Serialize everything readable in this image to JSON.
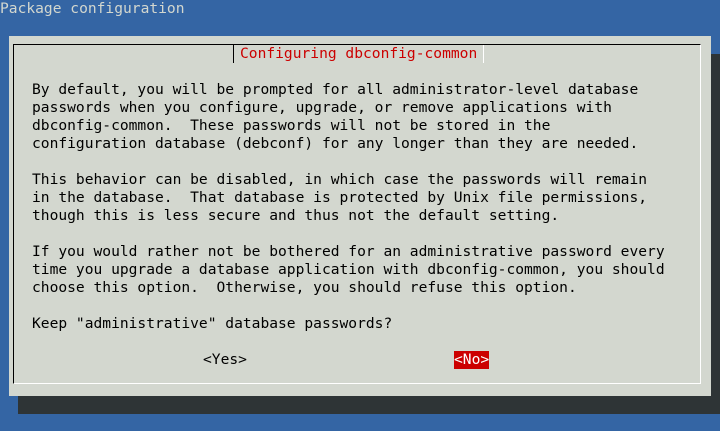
{
  "screen": {
    "title": "Package configuration"
  },
  "dialog": {
    "title": "Configuring dbconfig-common",
    "paragraphs": [
      "By default, you will be prompted for all administrator-level database\npasswords when you configure, upgrade, or remove applications with\ndbconfig-common.  These passwords will not be stored in the\nconfiguration database (debconf) for any longer than they are needed.",
      "This behavior can be disabled, in which case the passwords will remain\nin the database.  That database is protected by Unix file permissions,\nthough this is less secure and thus not the default setting.",
      "If you would rather not be bothered for an administrative password every\ntime you upgrade a database application with dbconfig-common, you should\nchoose this option.  Otherwise, you should refuse this option."
    ],
    "question": "Keep \"administrative\" database passwords?",
    "buttons": {
      "yes": "<Yes>",
      "no": "<No>"
    },
    "selected_button": "no"
  },
  "colors": {
    "background": "#3465a4",
    "dialog_background": "#d3d7cf",
    "shadow": "#2e3436",
    "accent": "#cc0000"
  }
}
